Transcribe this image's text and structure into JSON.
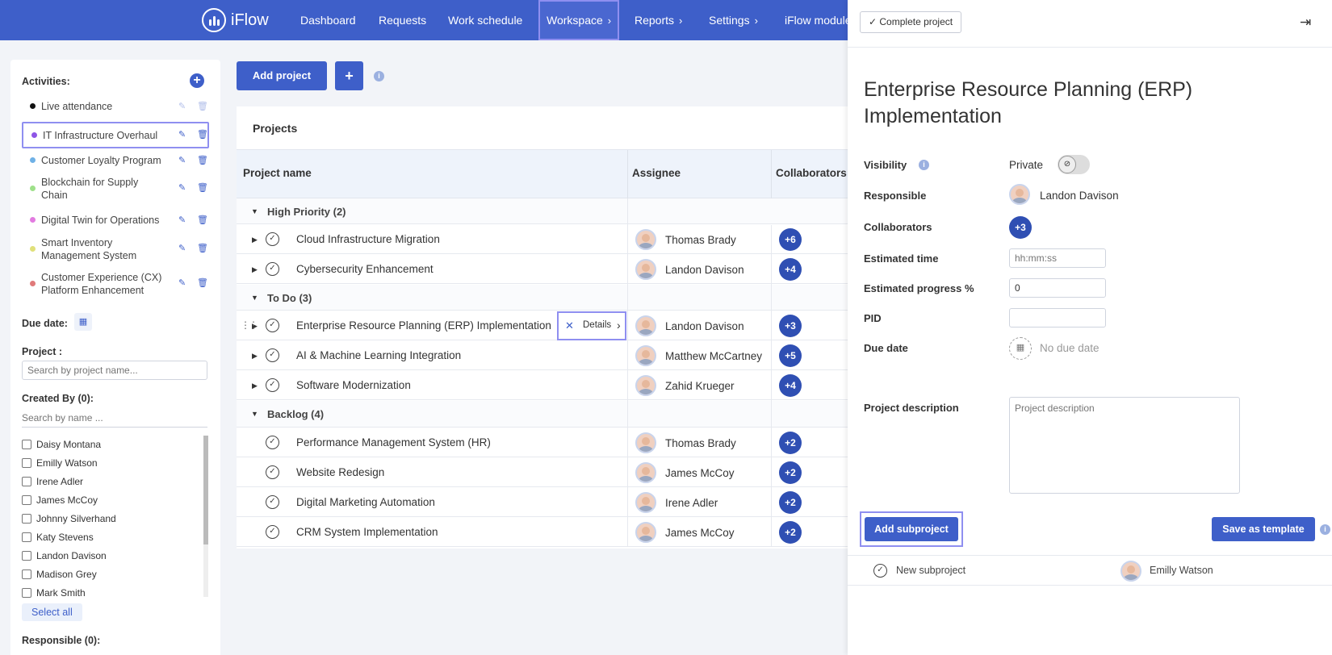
{
  "nav": {
    "brand": "iFlow",
    "items": [
      {
        "label": "Dashboard",
        "chevron": false
      },
      {
        "label": "Requests",
        "chevron": false
      },
      {
        "label": "Work schedule",
        "chevron": false
      },
      {
        "label": "Workspace",
        "chevron": true,
        "active": true
      },
      {
        "label": "Reports",
        "chevron": true
      },
      {
        "label": "Settings",
        "chevron": true
      },
      {
        "label": "iFlow module",
        "chevron": false
      }
    ]
  },
  "sidebar": {
    "activities_title": "Activities:",
    "activities": [
      {
        "label": "Live attendance",
        "color": "#111111"
      },
      {
        "label": "IT Infrastructure Overhaul",
        "color": "#8e55e6",
        "selected": true
      },
      {
        "label": "Customer Loyalty Program",
        "color": "#6fb1e6"
      },
      {
        "label": "Blockchain for Supply Chain",
        "color": "#9ee08a"
      },
      {
        "label": "Digital Twin for Operations",
        "color": "#e27be0"
      },
      {
        "label": "Smart Inventory Management System",
        "color": "#e0e07a"
      },
      {
        "label": "Customer Experience (CX) Platform Enhancement",
        "color": "#e07a7a"
      }
    ],
    "due_date_label": "Due date:",
    "project_label": "Project :",
    "project_placeholder": "Search by project name...",
    "created_by_label": "Created By (0):",
    "name_placeholder": "Search by name ...",
    "users": [
      "Daisy Montana",
      "Emilly Watson",
      "Irene Adler",
      "James McCoy",
      "Johnny Silverhand",
      "Katy Stevens",
      "Landon Davison",
      "Madison Grey",
      "Mark Smith"
    ],
    "select_all": "Select all",
    "responsible_label": "Responsible (0):"
  },
  "main": {
    "add_project": "Add project",
    "add_plus": "+",
    "panel_title": "Projects",
    "columns": {
      "name": "Project name",
      "assignee": "Assignee",
      "collaborators": "Collaborators"
    },
    "groups": [
      {
        "label": "High Priority (2)",
        "rows": [
          {
            "name": "Cloud Infrastructure Migration",
            "assignee": "Thomas Brady",
            "collab": "+6",
            "expandable": true
          },
          {
            "name": "Cybersecurity Enhancement",
            "assignee": "Landon Davison",
            "collab": "+4",
            "expandable": true
          }
        ]
      },
      {
        "label": "To Do (3)",
        "rows": [
          {
            "name": "Enterprise Resource Planning (ERP) Implementation",
            "assignee": "Landon Davison",
            "collab": "+3",
            "expandable": true,
            "active": true
          },
          {
            "name": "AI & Machine Learning Integration",
            "assignee": "Matthew McCartney",
            "collab": "+5",
            "expandable": true
          },
          {
            "name": "Software Modernization",
            "assignee": "Zahid Krueger",
            "collab": "+4",
            "expandable": true
          }
        ]
      },
      {
        "label": "Backlog (4)",
        "rows": [
          {
            "name": "Performance Management System (HR)",
            "assignee": "Thomas Brady",
            "collab": "+2",
            "expandable": false
          },
          {
            "name": "Website Redesign",
            "assignee": "James McCoy",
            "collab": "+2",
            "expandable": false
          },
          {
            "name": "Digital Marketing Automation",
            "assignee": "Irene Adler",
            "collab": "+2",
            "expandable": false
          },
          {
            "name": "CRM System Implementation",
            "assignee": "James McCoy",
            "collab": "+2",
            "expandable": false
          }
        ]
      }
    ],
    "details_label": "Details"
  },
  "detail": {
    "complete_button": "Complete project",
    "title": "Enterprise Resource Planning (ERP) Implementation",
    "visibility_label": "Visibility",
    "visibility_value": "Private",
    "responsible_label": "Responsible",
    "responsible_value": "Landon Davison",
    "collaborators_label": "Collaborators",
    "collaborators_value": "+3",
    "estimated_time_label": "Estimated time",
    "estimated_time_placeholder": "hh:mm:ss",
    "estimated_progress_label": "Estimated progress %",
    "estimated_progress_value": "0",
    "pid_label": "PID",
    "pid_value": "",
    "due_date_label": "Due date",
    "due_date_value": "No due date",
    "description_label": "Project description",
    "description_placeholder": "Project description",
    "add_subproject": "Add subproject",
    "save_template": "Save as template",
    "subproject_placeholder": "New subproject",
    "subproject_assignee": "Emilly Watson"
  },
  "colors": {
    "accent": "#3e5fc9",
    "badge": "#2f4fb3",
    "highlight": "#8f8ff0"
  }
}
